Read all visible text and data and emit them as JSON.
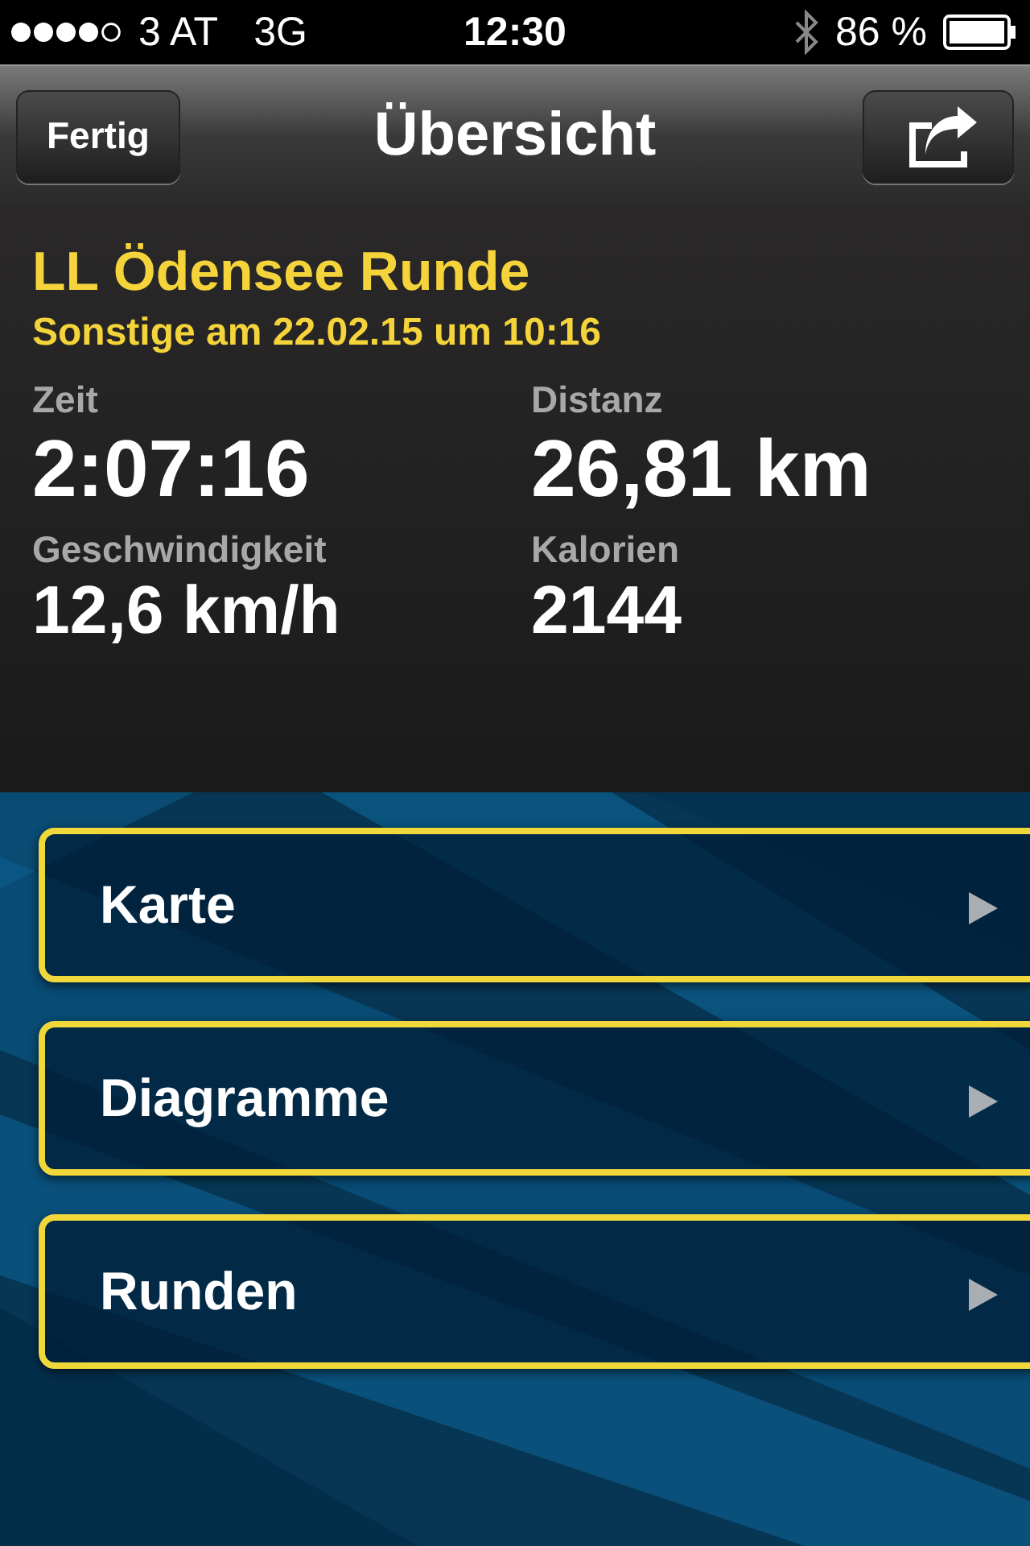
{
  "status_bar": {
    "carrier": "3 AT",
    "network": "3G",
    "time": "12:30",
    "battery": "86 %"
  },
  "nav_bar": {
    "left_button": "Fertig",
    "title": "Übersicht"
  },
  "activity": {
    "name": "LL Ödensee Runde",
    "subtitle": "Sonstige am 22.02.15 um 10:16",
    "stats": [
      {
        "label": "Zeit",
        "value": "2:07:16"
      },
      {
        "label": "Distanz",
        "value": "26,81 km"
      },
      {
        "label": "Geschwindigkeit",
        "value": "12,6 km/h"
      },
      {
        "label": "Kalorien",
        "value": "2144"
      }
    ]
  },
  "menu": [
    {
      "label": "Karte"
    },
    {
      "label": "Diagramme"
    },
    {
      "label": "Runden"
    }
  ]
}
